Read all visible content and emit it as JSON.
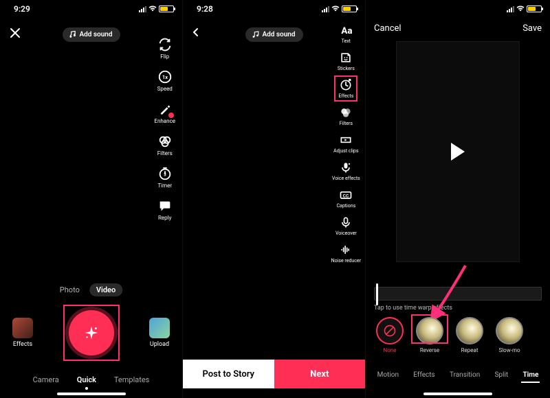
{
  "status": {
    "time1": "9:29",
    "time2": "9:28",
    "locGlyph": "➤"
  },
  "screen1": {
    "addSound": "Add sound",
    "tools": {
      "flip": "Flip",
      "speed": "Speed",
      "enhance": "Enhance",
      "filters": "Filters",
      "timer": "Timer",
      "reply": "Reply"
    },
    "modes": {
      "photo": "Photo",
      "video": "Video"
    },
    "sideButtons": {
      "effects": "Effects",
      "upload": "Upload"
    },
    "tabs": {
      "camera": "Camera",
      "quick": "Quick",
      "templates": "Templates"
    }
  },
  "screen2": {
    "addSound": "Add sound",
    "tools": {
      "text": "Text",
      "stickers": "Stickers",
      "effects": "Effects",
      "filters": "Filters",
      "adjustClips": "Adjust clips",
      "voiceEffects": "Voice effects",
      "captions": "Captions",
      "voiceover": "Voiceover",
      "noiseReducer": "Noise reducer"
    },
    "buttons": {
      "postToStory": "Post to Story",
      "next": "Next"
    }
  },
  "screen3": {
    "cancel": "Cancel",
    "save": "Save",
    "hint": "Tap to use time warp effects",
    "fx": {
      "none": "None",
      "reverse": "Reverse",
      "repeat": "Repeat",
      "slowmo": "Slow-mo"
    },
    "tabs": {
      "motion": "Motion",
      "effects": "Effects",
      "transition": "Transition",
      "split": "Split",
      "time": "Time"
    }
  },
  "colors": {
    "accent": "#ff2e55",
    "highlight": "#ff2e7a"
  }
}
